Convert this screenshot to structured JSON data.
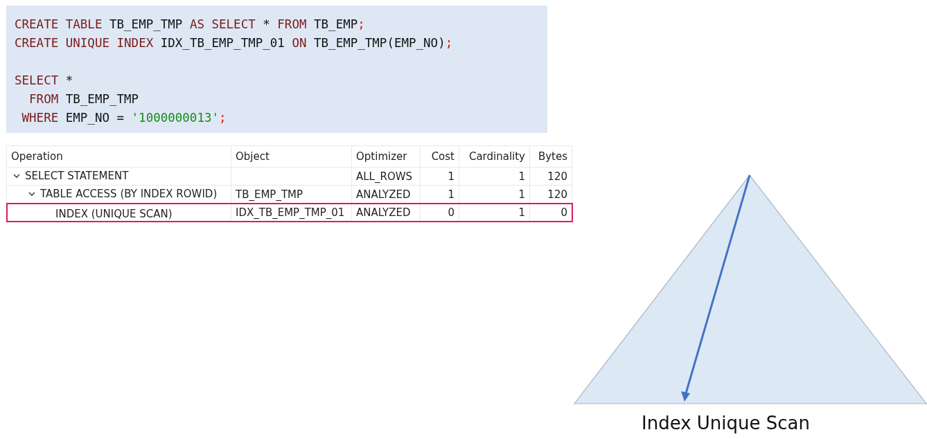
{
  "code": {
    "blocks": [
      {
        "lines": [
          [
            {
              "kind": "kw",
              "text": "CREATE "
            },
            {
              "kind": "kw",
              "text": "TABLE"
            },
            {
              "kind": "plain",
              "text": " TB_EMP_TMP "
            },
            {
              "kind": "kw",
              "text": "AS "
            },
            {
              "kind": "kw",
              "text": "SELECT"
            },
            {
              "kind": "plain",
              "text": " * "
            },
            {
              "kind": "kw",
              "text": "FROM"
            },
            {
              "kind": "plain",
              "text": " TB_EMP"
            },
            {
              "kind": "punct",
              "text": ";"
            }
          ],
          [
            {
              "kind": "kw",
              "text": "CREATE "
            },
            {
              "kind": "kw",
              "text": "UNIQUE "
            },
            {
              "kind": "kw",
              "text": "INDEX"
            },
            {
              "kind": "plain",
              "text": " IDX_TB_EMP_TMP_01 "
            },
            {
              "kind": "kw",
              "text": "ON"
            },
            {
              "kind": "plain",
              "text": " TB_EMP_TMP(EMP_NO)"
            },
            {
              "kind": "punct",
              "text": ";"
            }
          ]
        ]
      },
      {
        "lines": [
          [
            {
              "kind": "kw",
              "text": "SELECT"
            },
            {
              "kind": "plain",
              "text": " *"
            }
          ],
          [
            {
              "kind": "kw",
              "text": "  FROM"
            },
            {
              "kind": "plain",
              "text": " TB_EMP_TMP"
            }
          ],
          [
            {
              "kind": "kw",
              "text": " WHERE"
            },
            {
              "kind": "plain",
              "text": " EMP_NO = "
            },
            {
              "kind": "str",
              "text": "'1000000013'"
            },
            {
              "kind": "punct",
              "text": ";"
            }
          ]
        ]
      }
    ]
  },
  "plan": {
    "columns": [
      "Operation",
      "Object",
      "Optimizer",
      "Cost",
      "Cardinality",
      "Bytes"
    ],
    "rows": [
      {
        "operation": "SELECT STATEMENT",
        "optimizer": "ALL_ROWS",
        "cost": "1",
        "cardinality": "1",
        "bytes": "120",
        "expanded": true,
        "highlighted": false,
        "children": [
          {
            "operation": "TABLE ACCESS (BY INDEX ROWID)",
            "object": "TB_EMP_TMP",
            "optimizer": "ANALYZED",
            "cost": "1",
            "cardinality": "1",
            "bytes": "120",
            "expanded": true,
            "highlighted": false,
            "children": [
              {
                "operation": "INDEX (UNIQUE SCAN)",
                "object": "IDX_TB_EMP_TMP_01",
                "optimizer": "ANALYZED",
                "cost": "0",
                "cardinality": "1",
                "bytes": "0",
                "highlighted": true
              }
            ]
          }
        ]
      }
    ]
  },
  "diagram": {
    "caption": "Index Unique Scan"
  }
}
